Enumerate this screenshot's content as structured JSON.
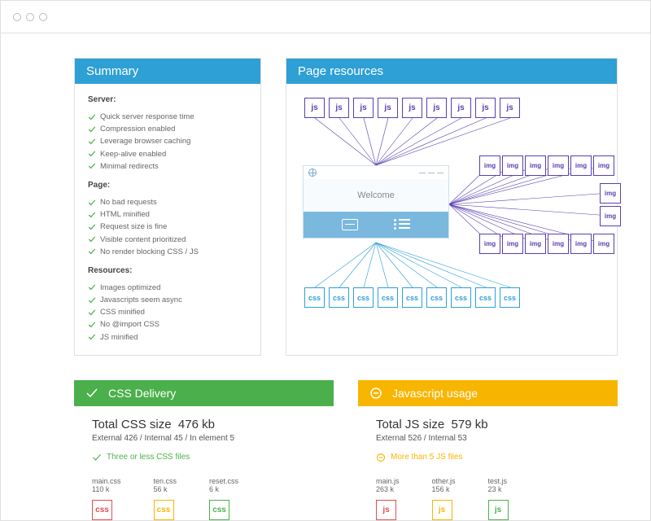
{
  "summary": {
    "title": "Summary",
    "server_label": "Server:",
    "server_items": [
      "Quick server response time",
      "Compression enabled",
      "Leverage browser caching",
      "Keep-alive enabled",
      "Minimal redirects"
    ],
    "page_label": "Page:",
    "page_items": [
      "No bad requests",
      "HTML minified",
      "Request size is fine",
      "Visible content prioritized",
      "No render blocking CSS / JS"
    ],
    "resources_label": "Resources:",
    "resources_items": [
      "Images optimized",
      "Javascripts seem async",
      "CSS minified",
      "No @import CSS",
      "JS minified"
    ]
  },
  "resources": {
    "title": "Page resources",
    "welcome": "Welcome",
    "js_label": "js",
    "img_label": "img",
    "css_label": "css"
  },
  "css_delivery": {
    "title": "CSS Delivery",
    "total_label": "Total CSS size",
    "total_value": "476 kb",
    "subtitle": "External 426 / Internal 45 / In element 5",
    "status": "Three or less CSS files",
    "files": [
      {
        "name": "main.css",
        "size": "110 k",
        "color": "red",
        "label": "css"
      },
      {
        "name": "ten.css",
        "size": "56 k",
        "color": "yellow",
        "label": "css"
      },
      {
        "name": "reset.css",
        "size": "6 k",
        "color": "green",
        "label": "css"
      }
    ]
  },
  "js_usage": {
    "title": "Javascript usage",
    "total_label": "Total JS size",
    "total_value": "579 kb",
    "subtitle": "External 526 / Internal 53",
    "status": "More than 5 JS files",
    "files": [
      {
        "name": "main.js",
        "size": "263 k",
        "color": "red",
        "label": "js"
      },
      {
        "name": "other.js",
        "size": "156 k",
        "color": "yellow",
        "label": "js"
      },
      {
        "name": "test.js",
        "size": "23 k",
        "color": "green",
        "label": "js"
      }
    ]
  }
}
